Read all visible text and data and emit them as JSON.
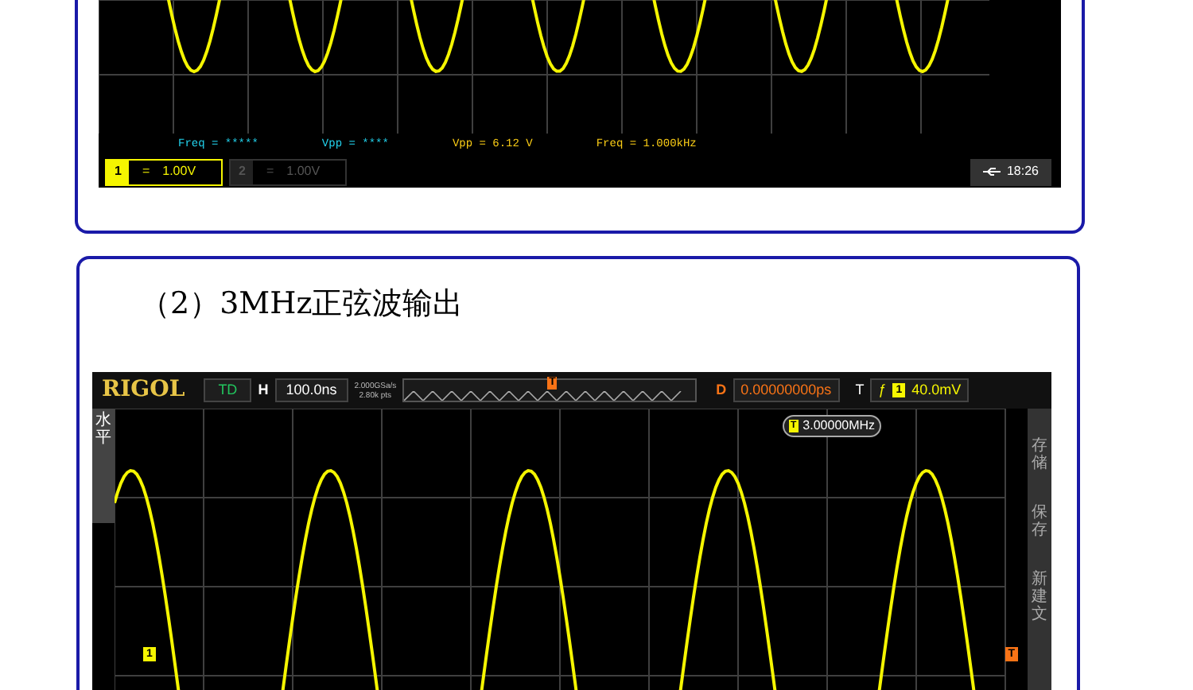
{
  "card_1": {
    "scope": {
      "measurements": [
        {
          "text": "Freq = *****",
          "color": "#22d3ee"
        },
        {
          "text": "Vpp = ****",
          "color": "#22d3ee"
        },
        {
          "text": "Vpp = 6.12 V",
          "color": "#facc15"
        },
        {
          "text": "Freq = 1.000kHz",
          "color": "#facc15"
        }
      ],
      "channels": [
        {
          "number": "1",
          "coupling": "=",
          "scale": "1.00V",
          "enabled": true
        },
        {
          "number": "2",
          "coupling": "=",
          "scale": "1.00V",
          "enabled": false
        }
      ],
      "clock": "18:26"
    }
  },
  "card_2": {
    "heading": "（2）3MHz正弦波输出",
    "scope": {
      "brand": "RIGOL",
      "mode": "TD",
      "timebase_label": "H",
      "timebase": "100.0ns",
      "sample_rate": "2.000GSa/s",
      "memory_depth": "2.80k pts",
      "delay_label": "D",
      "delay": "0.00000000ps",
      "trigger_label": "T",
      "trigger_edge": "ƒ",
      "trigger_source": "1",
      "trigger_level": "40.0mV",
      "trigger_position_marker": "T",
      "frequency_badge": {
        "icon": "T",
        "value": "3.00000MHz"
      },
      "left_menu": "水平",
      "right_menu": [
        "存储",
        "保存",
        "新建文"
      ],
      "channel_marker": "1",
      "trigger_level_marker": "T"
    }
  }
}
